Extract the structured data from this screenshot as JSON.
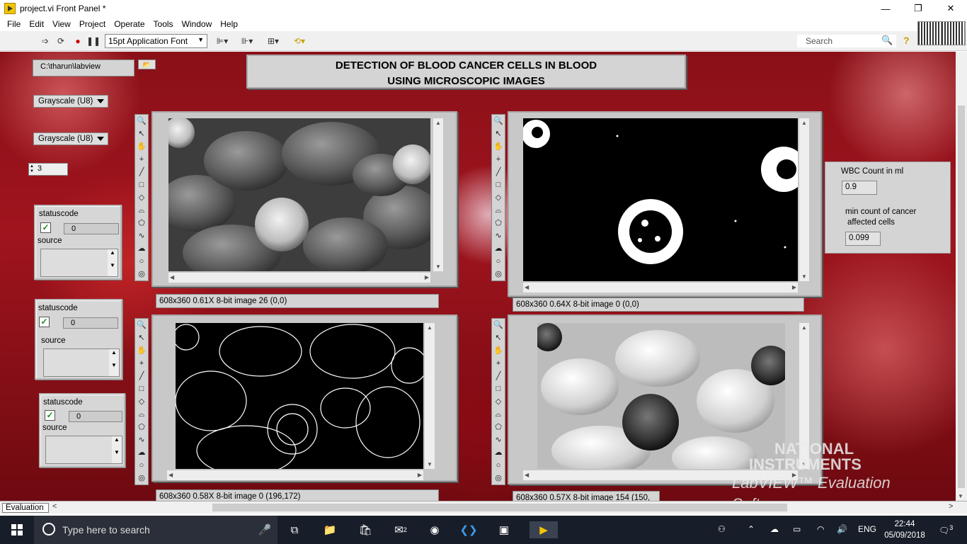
{
  "window": {
    "title": "project.vi Front Panel *",
    "minimize": "—",
    "maximize": "❐",
    "close": "✕"
  },
  "menu": [
    "File",
    "Edit",
    "View",
    "Project",
    "Operate",
    "Tools",
    "Window",
    "Help"
  ],
  "toolbar": {
    "font": "15pt Application Font",
    "search_placeholder": "Search",
    "help": "?"
  },
  "panel": {
    "heading_line1": "DETECTION OF BLOOD CANCER CELLS IN BLOOD",
    "heading_line2": "USING MICROSCOPIC IMAGES",
    "path": "C:\\tharun\\labview",
    "image_type_1": "Grayscale (U8)",
    "image_type_2": "Grayscale (U8)",
    "numeric": "3",
    "errors": [
      {
        "status_label": "status",
        "code_label": "code",
        "code": "0",
        "source_label": "source"
      },
      {
        "status_label": "status",
        "code_label": "code",
        "code": "0",
        "source_label": "source"
      },
      {
        "status_label": "status",
        "code_label": "code",
        "code": "0",
        "source_label": "source"
      }
    ],
    "image_displays": [
      {
        "info": "608x360 0.61X 8-bit image 26    (0,0)"
      },
      {
        "info": "608x360 0.64X 8-bit image 0    (0,0)"
      },
      {
        "info": "608x360 0.58X 8-bit image 0    (196,172)"
      },
      {
        "info": "608x360 0.57X 8-bit image 154    (150,"
      }
    ],
    "wbc_label": "WBC Count in ml",
    "wbc_value": "0.9",
    "min_label_line1": "min count of cancer",
    "min_label_line2": "affected cells",
    "min_value": "0.099",
    "watermark_line1": "NATIONAL",
    "watermark_line2": "INSTRUMENTS",
    "watermark_line3": "LabVIEW™ Evaluation Software"
  },
  "statusbar": {
    "label": "Evaluation"
  },
  "taskbar": {
    "search_placeholder": "Type here to search",
    "mail_badge": "2",
    "lang": "ENG",
    "time": "22:44",
    "date": "05/09/2018",
    "notif_count": "3"
  },
  "colors": {
    "taskbar": "#181e29",
    "panel_bg": "#8a1018",
    "accent": "#1a8a1a"
  }
}
